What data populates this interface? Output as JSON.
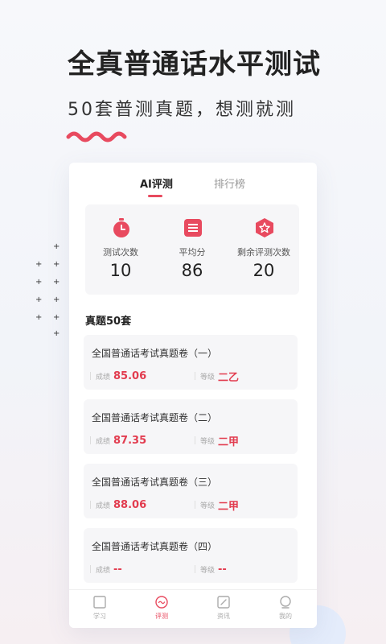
{
  "promo": {
    "headline": "全真普通话水平测试",
    "subline": "50套普测真题，想测就测"
  },
  "tabs": [
    {
      "label": "AI评测",
      "active": true
    },
    {
      "label": "排行榜",
      "active": false
    }
  ],
  "stats": [
    {
      "icon": "timer-icon",
      "label": "测试次数",
      "value": "10"
    },
    {
      "icon": "list-icon",
      "label": "平均分",
      "value": "86"
    },
    {
      "icon": "star-icon",
      "label": "剩余评测次数",
      "value": "20"
    }
  ],
  "section": {
    "title": "真题50套"
  },
  "papers": [
    {
      "title": "全国普通话考试真题卷（一）",
      "score_label": "成绩",
      "score": "85.06",
      "grade_label": "等级",
      "grade": "二乙"
    },
    {
      "title": "全国普通话考试真题卷（二）",
      "score_label": "成绩",
      "score": "87.35",
      "grade_label": "等级",
      "grade": "二甲"
    },
    {
      "title": "全国普通话考试真题卷（三）",
      "score_label": "成绩",
      "score": "88.06",
      "grade_label": "等级",
      "grade": "二甲"
    },
    {
      "title": "全国普通话考试真题卷（四）",
      "score_label": "成绩",
      "score": "--",
      "grade_label": "等级",
      "grade": "--"
    }
  ],
  "nav": [
    {
      "label": "学习",
      "icon": "book-icon",
      "active": false
    },
    {
      "label": "评测",
      "icon": "assess-icon",
      "active": true
    },
    {
      "label": "资讯",
      "icon": "news-icon",
      "active": false
    },
    {
      "label": "我的",
      "icon": "profile-icon",
      "active": false
    }
  ],
  "colors": {
    "accent": "#e84a5f",
    "value_red": "#e23c4f"
  }
}
